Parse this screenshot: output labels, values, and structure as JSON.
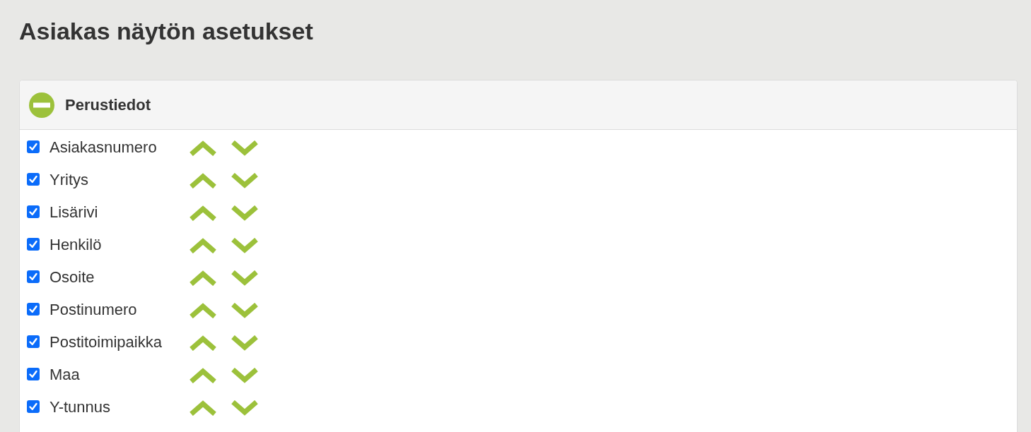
{
  "page": {
    "title": "Asiakas näytön asetukset"
  },
  "sections": [
    {
      "title": "Perustiedot",
      "expanded": true,
      "fields": [
        {
          "label": "Asiakasnumero",
          "checked": true
        },
        {
          "label": "Yritys",
          "checked": true
        },
        {
          "label": "Lisärivi",
          "checked": true
        },
        {
          "label": "Henkilö",
          "checked": true
        },
        {
          "label": "Osoite",
          "checked": true
        },
        {
          "label": "Postinumero",
          "checked": true
        },
        {
          "label": "Postitoimipaikka",
          "checked": true
        },
        {
          "label": "Maa",
          "checked": true
        },
        {
          "label": "Y-tunnus",
          "checked": true
        }
      ]
    }
  ]
}
